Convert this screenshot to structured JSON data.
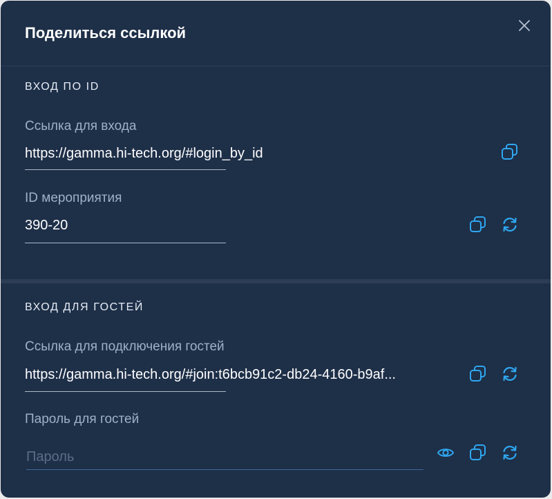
{
  "dialog": {
    "title": "Поделиться ссылкой"
  },
  "login_by_id": {
    "section_title": "ВХОД ПО ID",
    "link_label": "Ссылка для входа",
    "link_value": "https://gamma.hi-tech.org/#login_by_id",
    "event_id_label": "ID мероприятия",
    "event_id_value": "390-20"
  },
  "guest_access": {
    "section_title": "ВХОД ДЛЯ ГОСТЕЙ",
    "guest_link_label": "Ссылка для подключения гостей",
    "guest_link_value": "https://gamma.hi-tech.org/#join:t6bcb91c2-db24-4160-b9af...",
    "password_label": "Пароль для гостей",
    "password_placeholder": "Пароль",
    "password_value": ""
  },
  "colors": {
    "background": "#1e2f48",
    "accent": "#2fa7f0",
    "muted_text": "#9fb0c9"
  },
  "icons": [
    "close-icon",
    "copy-icon",
    "refresh-icon",
    "eye-icon"
  ]
}
